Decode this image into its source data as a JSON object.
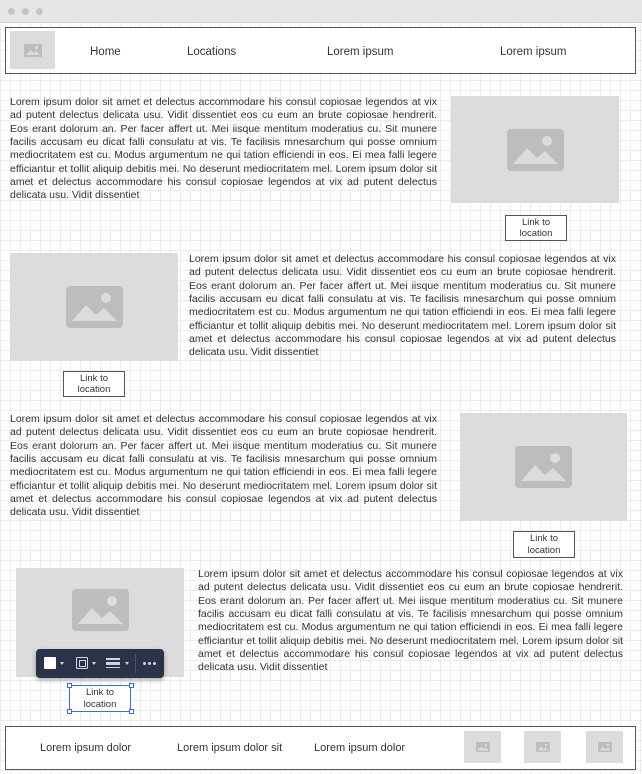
{
  "header": {
    "nav": [
      "Home",
      "Locations",
      "Lorem ipsum",
      "Lorem ipsum"
    ]
  },
  "body_text": "Lorem ipsum dolor sit amet et delectus accommodare his consul copiosae legendos at vix ad putent delectus delicata usu. Vidit dissentiet eos cu eum an brute copiosae hendrerit. Eos erant dolorum an. Per facer affert ut. Mei iisque mentitum moderatius cu. Sit munere facilis accusam eu dicat falli consulatu at vis. Te facilisis mnesarchum qui posse omnium mediocritatem est cu. Modus argumentum ne qui tation efficiendi in eos. Ei mea falli legere efficiantur et tollit aliquip debitis mei. No deserunt mediocritatem mel. Lorem ipsum dolor sit amet et delectus accommodare his consul copiosae legendos at vix ad putent delectus delicata usu. Vidit dissentiet",
  "sections": [
    {
      "link_label": "Link to location"
    },
    {
      "link_label": "Link to location"
    },
    {
      "link_label": "Link to location"
    },
    {
      "link_label": "Link to location"
    }
  ],
  "footer": {
    "links": [
      "Lorem ipsum dolor",
      "Lorem ipsum dolor sit",
      "Lorem ipsum dolor"
    ]
  },
  "toolbar": {
    "icons": [
      "fill-color-icon",
      "border-style-icon",
      "line-style-icon",
      "more-options-icon"
    ]
  },
  "colors": {
    "placeholder": "#dcdcdc",
    "placeholder_glyph": "#bdbdbd",
    "toolbar_bg": "#2a3347",
    "selection": "#3b6fd6"
  }
}
